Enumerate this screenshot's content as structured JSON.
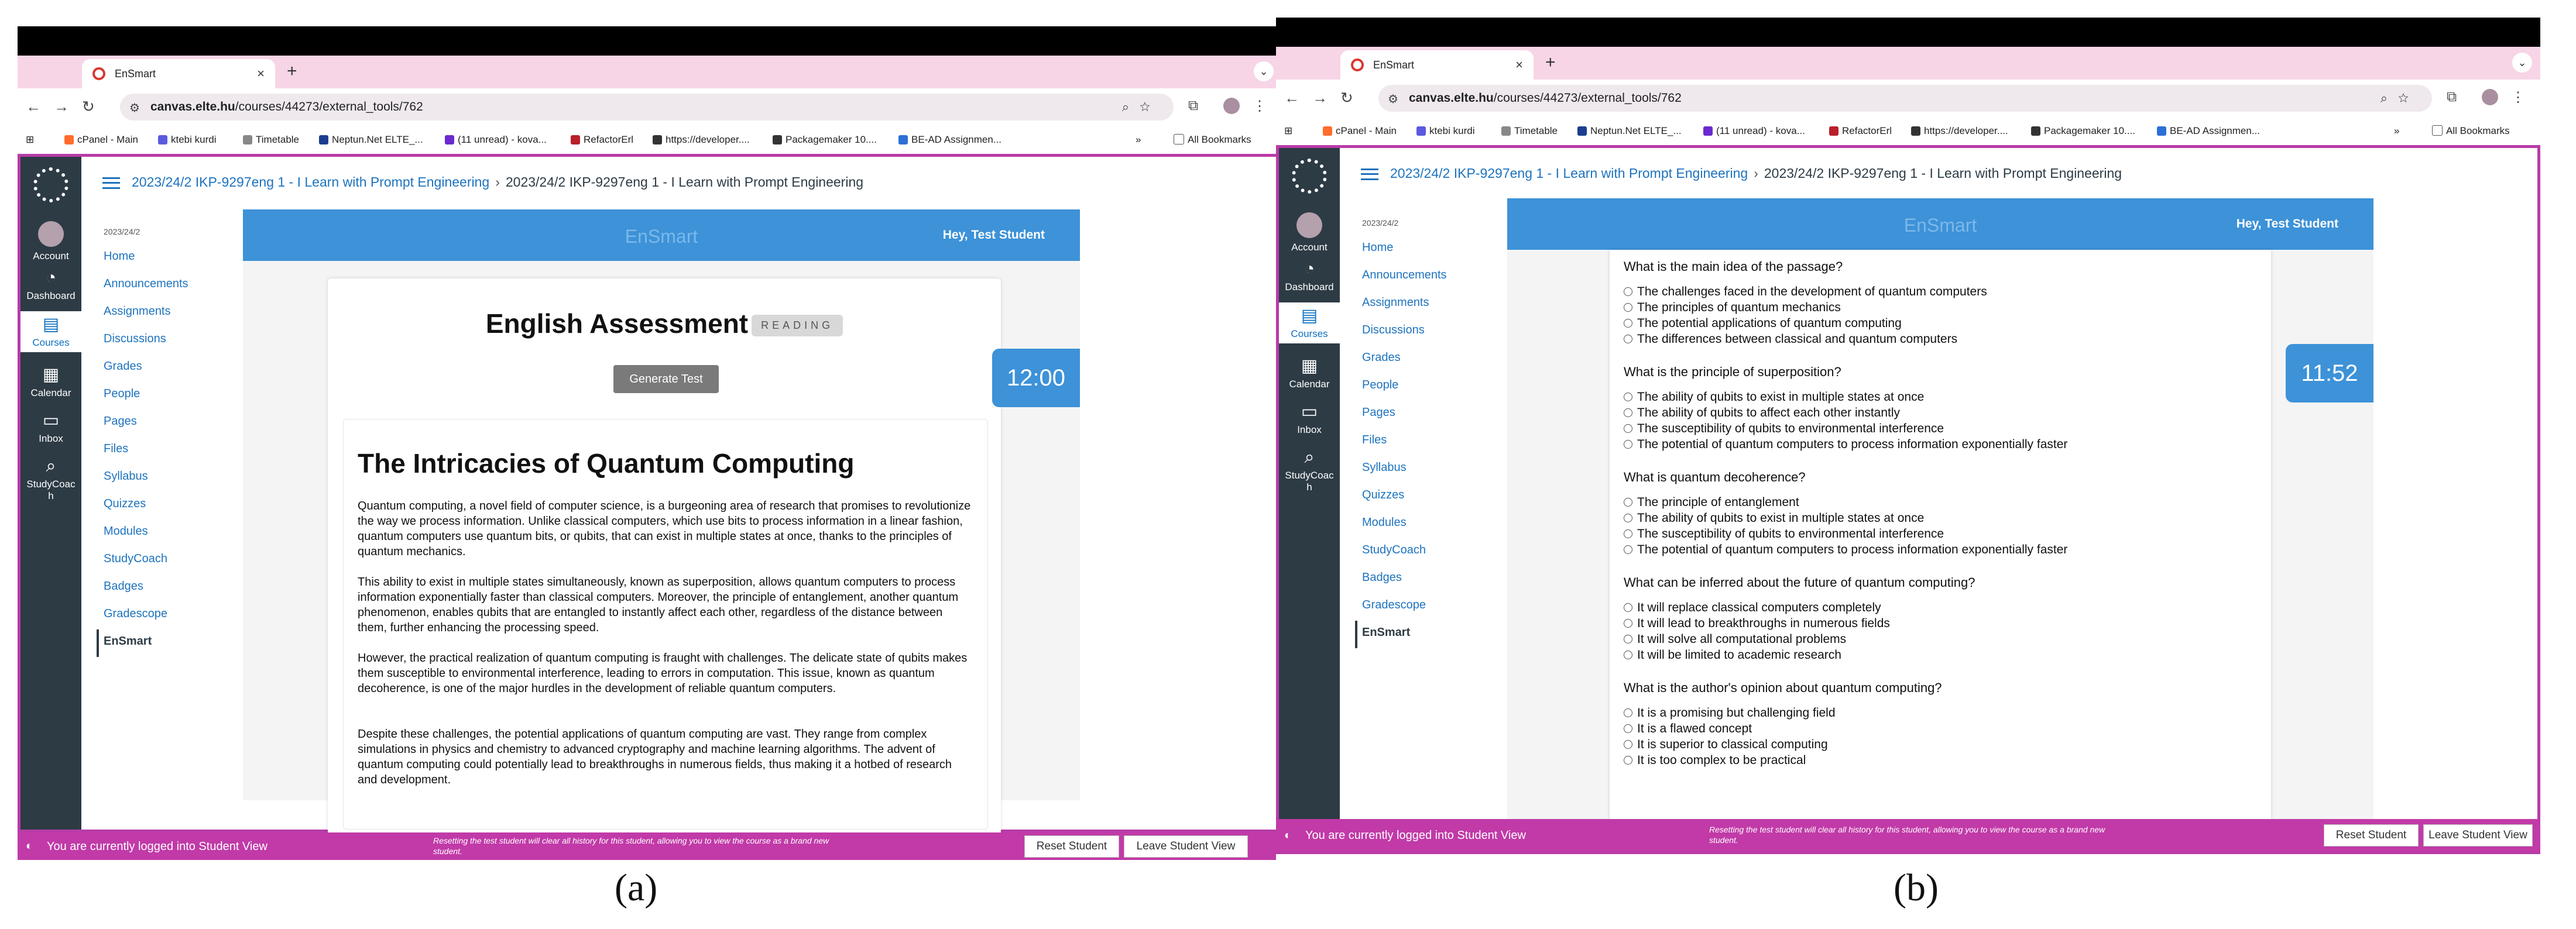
{
  "browser": {
    "tab_title": "EnSmart",
    "url_host": "canvas.elte.hu",
    "url_path": "/courses/44273/external_tools/762",
    "bookmarks": [
      "cPanel - Main",
      "ktebi kurdi",
      "Timetable",
      "Neptun.Net ELTE_...",
      "(11 unread) - kova...",
      "RefactorErl",
      "https://developer....",
      "Packagemaker 10....",
      "BE-AD Assignmen..."
    ],
    "all_bookmarks": "All Bookmarks",
    "more": "»"
  },
  "global_nav": {
    "items": [
      {
        "label": "Account",
        "icon": "account-icon"
      },
      {
        "label": "Dashboard",
        "icon": "dashboard-icon"
      },
      {
        "label": "Courses",
        "icon": "courses-icon"
      },
      {
        "label": "Calendar",
        "icon": "calendar-icon"
      },
      {
        "label": "Inbox",
        "icon": "inbox-icon"
      },
      {
        "label": "StudyCoac\nh",
        "icon": "studycoach-icon"
      }
    ],
    "active": "Courses"
  },
  "breadcrumb": {
    "link": "2023/24/2 IKP-9297eng 1 - I Learn with Prompt Engineering",
    "separator": "›",
    "current": "2023/24/2 IKP-9297eng 1 - I Learn with Prompt Engineering"
  },
  "course_nav": {
    "term": "2023/24/2",
    "items": [
      "Home",
      "Announcements",
      "Assignments",
      "Discussions",
      "Grades",
      "People",
      "Pages",
      "Files",
      "Syllabus",
      "Quizzes",
      "Modules",
      "StudyCoach",
      "Badges",
      "Gradescope",
      "EnSmart"
    ],
    "active": "EnSmart"
  },
  "tool": {
    "brand": "EnSmart",
    "greeting": "Hey, Test Student"
  },
  "panel_a": {
    "timer": "12:00",
    "title": "English Assessment",
    "badge": "READING",
    "generate_button": "Generate Test",
    "passage_title": "The Intricacies of Quantum Computing",
    "paragraphs": [
      "Quantum computing, a novel field of computer science, is a burgeoning area of research that promises to revolutionize the way we process information. Unlike classical computers, which use bits to process information in a linear fashion, quantum computers use quantum bits, or qubits, that can exist in multiple states at once, thanks to the principles of quantum mechanics.",
      "This ability to exist in multiple states simultaneously, known as superposition, allows quantum computers to process information exponentially faster than classical computers. Moreover, the principle of entanglement, another quantum phenomenon, enables qubits that are entangled to instantly affect each other, regardless of the distance between them, further enhancing the processing speed.",
      "However, the practical realization of quantum computing is fraught with challenges. The delicate state of qubits makes them susceptible to environmental interference, leading to errors in computation. This issue, known as quantum decoherence, is one of the major hurdles in the development of reliable quantum computers.",
      "Despite these challenges, the potential applications of quantum computing are vast. They range from complex simulations in physics and chemistry to advanced cryptography and machine learning algorithms. The advent of quantum computing could potentially lead to breakthroughs in numerous fields, thus making it a hotbed of research and development."
    ],
    "caption": "(a)"
  },
  "panel_b": {
    "timer": "11:52",
    "questions": [
      {
        "q": "What is the main idea of the passage?",
        "options": [
          "The challenges faced in the development of quantum computers",
          "The principles of quantum mechanics",
          "The potential applications of quantum computing",
          "The differences between classical and quantum computers"
        ]
      },
      {
        "q": "What is the principle of superposition?",
        "options": [
          "The ability of qubits to exist in multiple states at once",
          "The ability of qubits to affect each other instantly",
          "The susceptibility of qubits to environmental interference",
          "The potential of quantum computers to process information exponentially faster"
        ]
      },
      {
        "q": "What is quantum decoherence?",
        "options": [
          "The principle of entanglement",
          "The ability of qubits to exist in multiple states at once",
          "The susceptibility of qubits to environmental interference",
          "The potential of quantum computers to process information exponentially faster"
        ]
      },
      {
        "q": "What can be inferred about the future of quantum computing?",
        "options": [
          "It will replace classical computers completely",
          "It will lead to breakthroughs in numerous fields",
          "It will solve all computational problems",
          "It will be limited to academic research"
        ]
      },
      {
        "q": "What is the author's opinion about quantum computing?",
        "options": [
          "It is a promising but challenging field",
          "It is a flawed concept",
          "It is superior to classical computing",
          "It is too complex to be practical"
        ]
      }
    ],
    "caption": "(b)"
  },
  "student_bar": {
    "text": "You are currently logged into Student View",
    "note": "Resetting the test student will clear all history for this student, allowing you to view the course as a brand new student.",
    "reset": "Reset Student",
    "leave": "Leave Student View"
  },
  "colors": {
    "canvas_nav": "#2d3b45",
    "link": "#1e73be",
    "tool_header": "#3d92d8",
    "student_bar": "#c13aa8",
    "tab_strip": "#f7d5e6"
  }
}
